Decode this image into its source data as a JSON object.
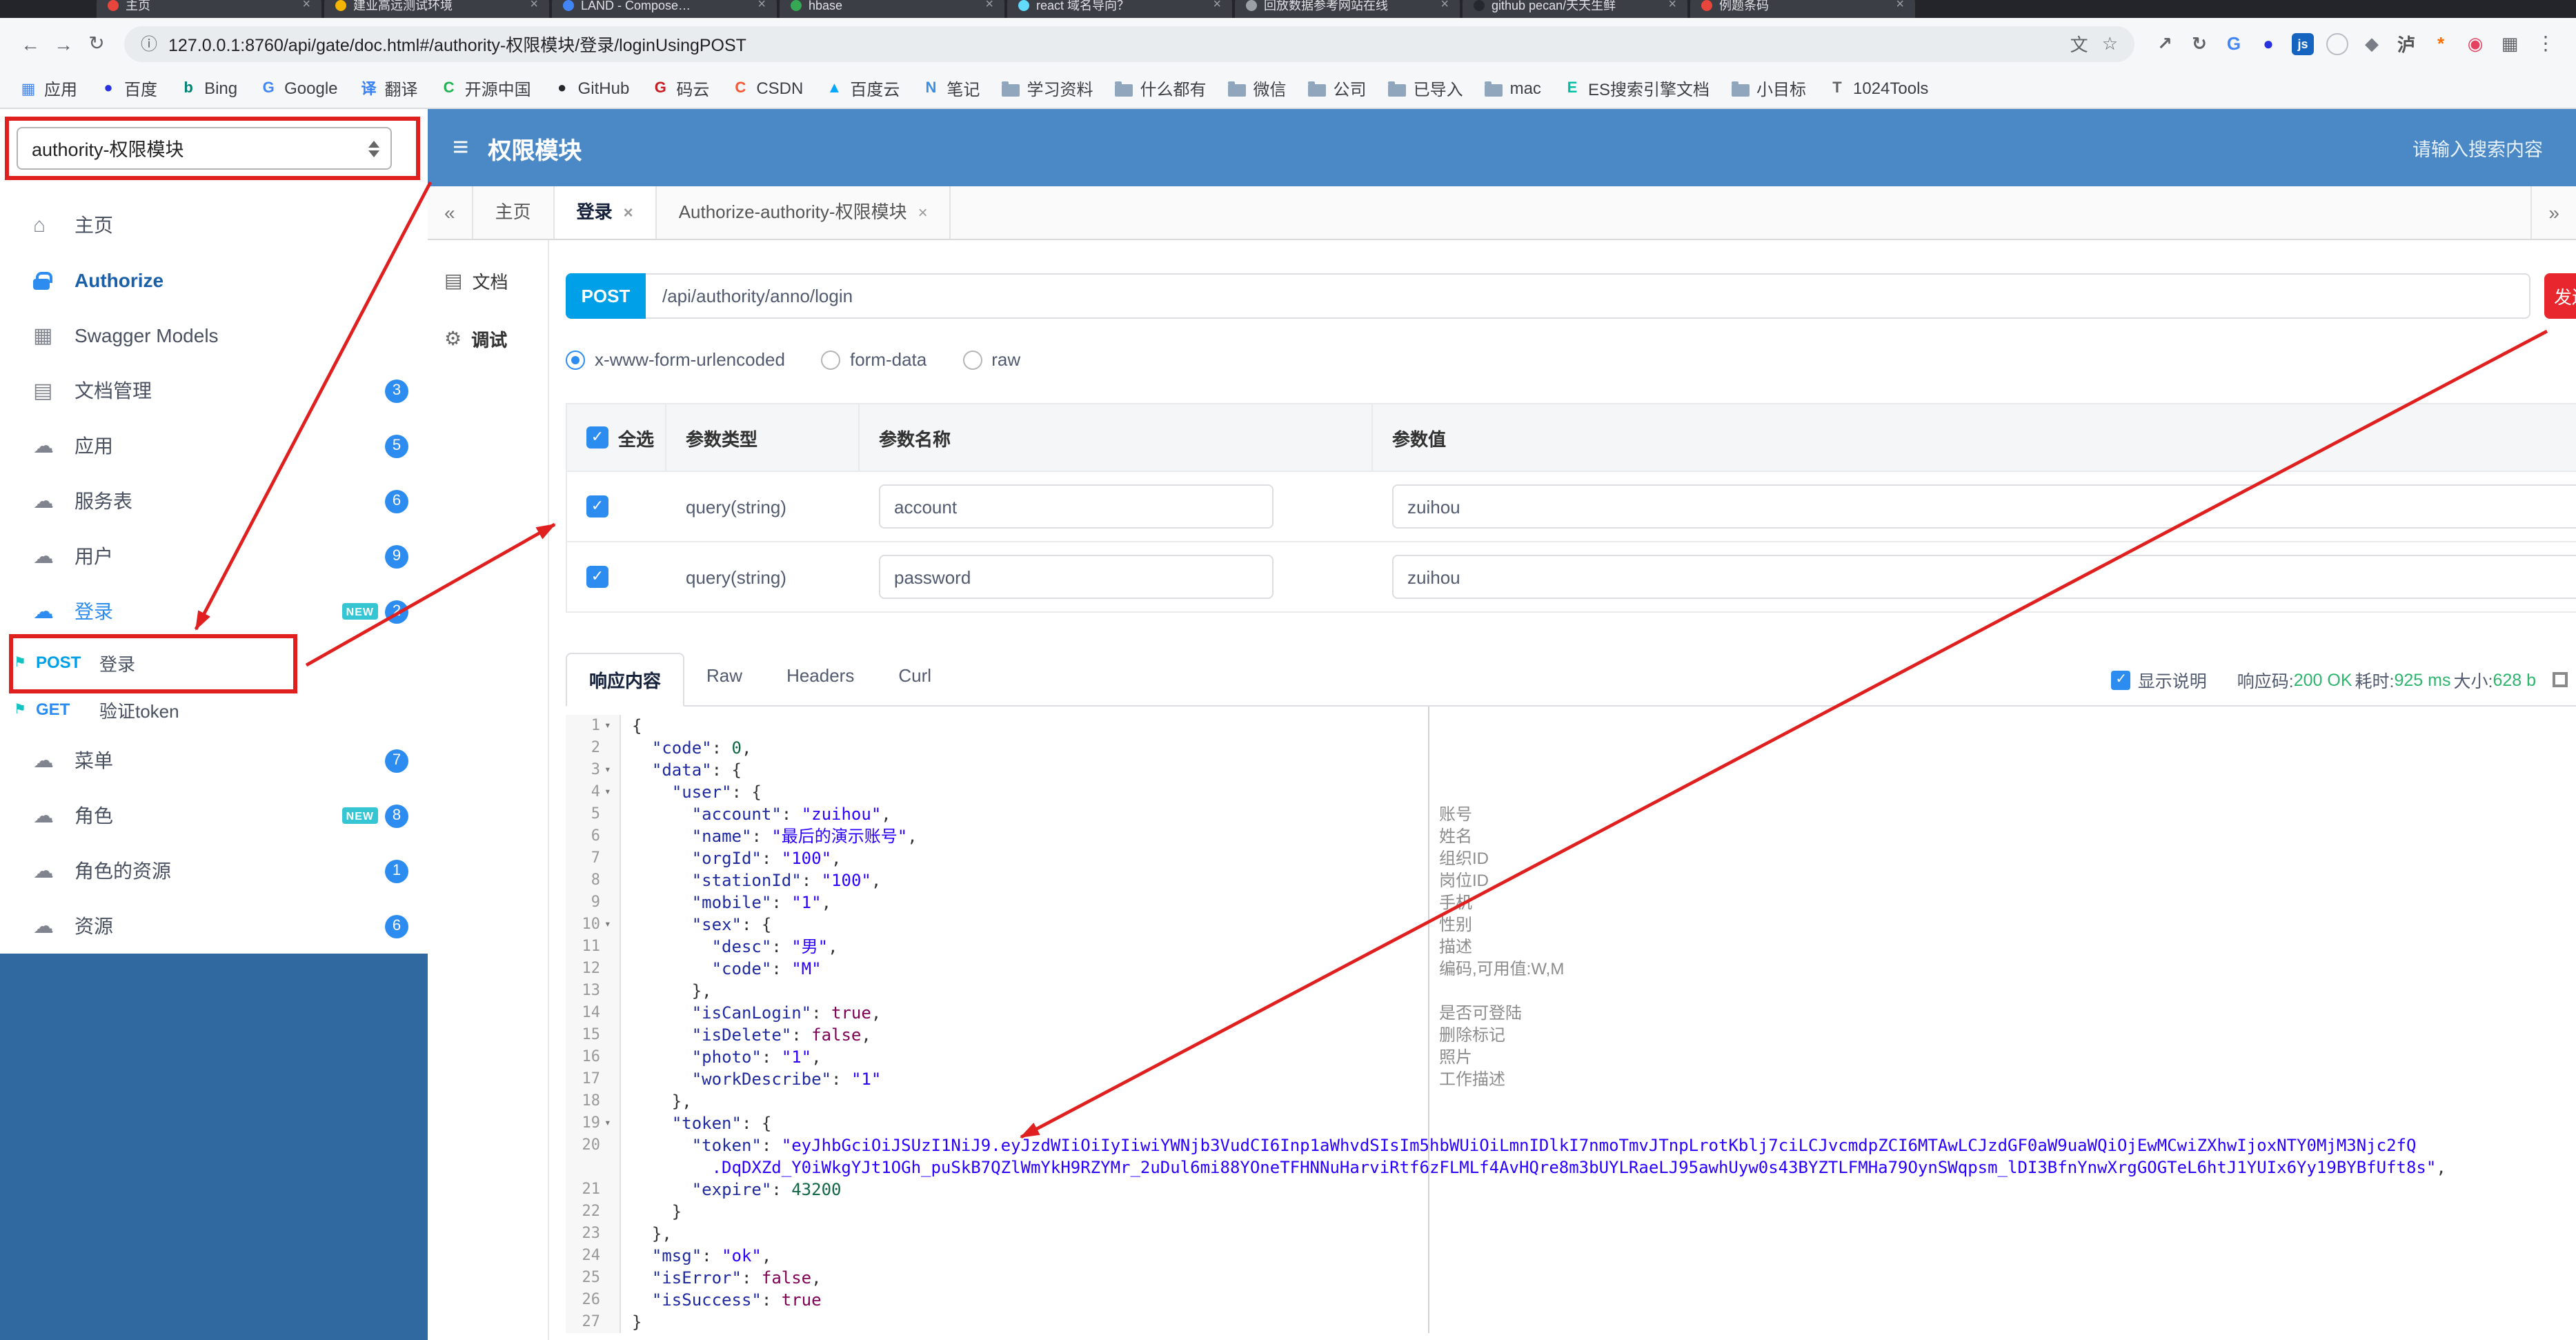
{
  "browser": {
    "window_tabs": [
      {
        "title": "主页",
        "color": "#e8453c"
      },
      {
        "title": "建业高远测试环境",
        "color": "#f4b400"
      },
      {
        "title": "LAND - Compose…",
        "color": "#4285f4"
      },
      {
        "title": "hbase",
        "color": "#34a853"
      },
      {
        "title": "react 域名导向？",
        "color": "#61dafb"
      },
      {
        "title": "回放数据参考网站在线",
        "color": "#9aa0a6"
      },
      {
        "title": "github pecan/天天生鲜",
        "color": "#24292e"
      },
      {
        "title": "例题条码",
        "color": "#e8453c"
      }
    ],
    "nav": {
      "back": "←",
      "forward": "→",
      "reload": "↻",
      "info": "ⓘ",
      "menu": "⋮"
    },
    "url": "127.0.0.1:8760/api/gate/doc.html#/authority-权限模块/登录/loginUsingPOST",
    "omnibox_icons": {
      "translate": "文",
      "star": "☆"
    },
    "ext_icons": [
      {
        "name": "share-extension-icon",
        "glyph": "↗",
        "color": "#5f6368"
      },
      {
        "name": "history-extension-icon",
        "glyph": "↻",
        "color": "#5f6368"
      },
      {
        "name": "google-extension-icon",
        "glyph": "G",
        "color": "#4285f4"
      },
      {
        "name": "paw-extension-icon",
        "glyph": "●",
        "color": "#2932e1"
      },
      {
        "name": "jsfiddle-extension-icon",
        "glyph": "js",
        "bg": "#1565c0",
        "fg": "#ffffff"
      },
      {
        "name": "circle-extension-icon",
        "glyph": "",
        "border": true
      },
      {
        "name": "shield-extension-icon",
        "glyph": "◆",
        "color": "#7a7f87"
      },
      {
        "name": "hujiang-extension-icon",
        "glyph": "泸",
        "color": "#555555"
      },
      {
        "name": "asterisk-extension-icon",
        "glyph": "*",
        "color": "#ff6d00"
      },
      {
        "name": "pin-extension-icon",
        "glyph": "◉",
        "color": "#e4405f"
      },
      {
        "name": "apps-grid-extension-icon",
        "glyph": "▦",
        "color": "#5f6368"
      }
    ],
    "bookmarks": [
      {
        "label": "应用",
        "glyph": "▦",
        "color": "#4285f4"
      },
      {
        "label": "百度",
        "glyph": "●",
        "color": "#2932e1"
      },
      {
        "label": "Bing",
        "glyph": "b",
        "color": "#008373"
      },
      {
        "label": "Google",
        "glyph": "G",
        "color": "#4285f4"
      },
      {
        "label": "翻译",
        "glyph": "译",
        "color": "#3b82f6"
      },
      {
        "label": "开源中国",
        "glyph": "C",
        "color": "#21b351"
      },
      {
        "label": "GitHub",
        "glyph": "●",
        "color": "#24292e"
      },
      {
        "label": "码云",
        "glyph": "G",
        "color": "#c71d23"
      },
      {
        "label": "CSDN",
        "glyph": "C",
        "color": "#fc5531"
      },
      {
        "label": "百度云",
        "glyph": "▲",
        "color": "#06a7ff"
      },
      {
        "label": "笔记",
        "glyph": "N",
        "color": "#3a8ee6"
      },
      {
        "label": "学习资料",
        "folder": true
      },
      {
        "label": "什么都有",
        "folder": true
      },
      {
        "label": "微信",
        "folder": true
      },
      {
        "label": "公司",
        "folder": true
      },
      {
        "label": "已导入",
        "folder": true
      },
      {
        "label": "mac",
        "folder": true
      },
      {
        "label": "ES搜索引擎文档",
        "glyph": "E",
        "color": "#00bfa5"
      },
      {
        "label": "小目标",
        "folder": true
      },
      {
        "label": "1024Tools",
        "glyph": "T",
        "color": "#616161"
      }
    ]
  },
  "header": {
    "group_select": "authority-权限模块",
    "menu_icon": "≡",
    "title": "权限模块",
    "search_placeholder": "请输入搜索内容"
  },
  "sidebar": {
    "items": [
      {
        "id": "home",
        "label": "主页",
        "icon": "home"
      },
      {
        "id": "authorize",
        "label": "Authorize",
        "icon": "lock",
        "strong": true
      },
      {
        "id": "swagger-models",
        "label": "Swagger Models",
        "icon": "grid"
      },
      {
        "id": "docs-manage",
        "label": "文档管理",
        "icon": "doc",
        "badge": "3"
      },
      {
        "id": "app",
        "label": "应用",
        "icon": "cloud",
        "badge": "5"
      },
      {
        "id": "service",
        "label": "服务表",
        "icon": "cloud",
        "badge": "6"
      },
      {
        "id": "user",
        "label": "用户",
        "icon": "cloud",
        "badge": "9"
      },
      {
        "id": "login",
        "label": "登录",
        "icon": "cloud",
        "badge": "2",
        "new": true,
        "active": true,
        "expanded": true
      },
      {
        "id": "menu",
        "label": "菜单",
        "icon": "cloud",
        "badge": "7"
      },
      {
        "id": "role",
        "label": "角色",
        "icon": "cloud",
        "badge": "8",
        "new": true
      },
      {
        "id": "role-resource",
        "label": "角色的资源",
        "icon": "cloud",
        "badge": "1"
      },
      {
        "id": "resource",
        "label": "资源",
        "icon": "cloud",
        "badge": "6"
      }
    ],
    "sub_items": [
      {
        "method": "POST",
        "label": "登录"
      },
      {
        "method": "GET",
        "label": "验证token"
      }
    ]
  },
  "tabs": {
    "collapse_left": "«",
    "collapse_right": "»",
    "items": [
      {
        "label": "主页",
        "closable": false
      },
      {
        "label": "登录",
        "closable": true,
        "active": true
      },
      {
        "label": "Authorize-authority-权限模块",
        "closable": true
      }
    ]
  },
  "side_menu": [
    {
      "label": "文档",
      "icon": "doc"
    },
    {
      "label": "调试",
      "icon": "debug",
      "active": true
    }
  ],
  "debug": {
    "method": "POST",
    "url": "/api/authority/anno/login",
    "send_label": "发送",
    "content_types": [
      "x-www-form-urlencoded",
      "form-data",
      "raw"
    ],
    "selected_content_type": 0,
    "params": {
      "headers": [
        "全选",
        "参数类型",
        "参数名称",
        "参数值"
      ],
      "rows": [
        {
          "checked": true,
          "type": "query(string)",
          "name": "account",
          "value": "zuihou"
        },
        {
          "checked": true,
          "type": "query(string)",
          "name": "password",
          "value": "zuihou"
        }
      ]
    },
    "response_tabs": [
      "响应内容",
      "Raw",
      "Headers",
      "Curl"
    ],
    "active_response_tab": 0,
    "show_desc_label": "显示说明",
    "show_desc_checked": true,
    "status": {
      "code_label": "响应码:",
      "code": "200 OK",
      "time_label": "耗时:",
      "time": "925 ms",
      "size_label": "大小:",
      "size": "628 b"
    }
  },
  "code": {
    "lines": [
      {
        "n": 1,
        "fold": true,
        "parts": [
          [
            "p",
            "{"
          ]
        ]
      },
      {
        "n": 2,
        "parts": [
          [
            "p",
            "  "
          ],
          [
            "k",
            "\"code\""
          ],
          [
            "p",
            ": "
          ],
          [
            "num",
            "0"
          ],
          [
            "p",
            ","
          ]
        ]
      },
      {
        "n": 3,
        "fold": true,
        "parts": [
          [
            "p",
            "  "
          ],
          [
            "k",
            "\"data\""
          ],
          [
            "p",
            ": {"
          ]
        ]
      },
      {
        "n": 4,
        "fold": true,
        "parts": [
          [
            "p",
            "    "
          ],
          [
            "k",
            "\"user\""
          ],
          [
            "p",
            ": {"
          ]
        ]
      },
      {
        "n": 5,
        "parts": [
          [
            "p",
            "      "
          ],
          [
            "k",
            "\"account\""
          ],
          [
            "p",
            ": "
          ],
          [
            "s",
            "\"zuihou\""
          ],
          [
            "p",
            ","
          ]
        ]
      },
      {
        "n": 6,
        "parts": [
          [
            "p",
            "      "
          ],
          [
            "k",
            "\"name\""
          ],
          [
            "p",
            ": "
          ],
          [
            "s",
            "\"最后的演示账号\""
          ],
          [
            "p",
            ","
          ]
        ]
      },
      {
        "n": 7,
        "parts": [
          [
            "p",
            "      "
          ],
          [
            "k",
            "\"orgId\""
          ],
          [
            "p",
            ": "
          ],
          [
            "s",
            "\"100\""
          ],
          [
            "p",
            ","
          ]
        ]
      },
      {
        "n": 8,
        "parts": [
          [
            "p",
            "      "
          ],
          [
            "k",
            "\"stationId\""
          ],
          [
            "p",
            ": "
          ],
          [
            "s",
            "\"100\""
          ],
          [
            "p",
            ","
          ]
        ]
      },
      {
        "n": 9,
        "parts": [
          [
            "p",
            "      "
          ],
          [
            "k",
            "\"mobile\""
          ],
          [
            "p",
            ": "
          ],
          [
            "s",
            "\"1\""
          ],
          [
            "p",
            ","
          ]
        ]
      },
      {
        "n": 10,
        "fold": true,
        "parts": [
          [
            "p",
            "      "
          ],
          [
            "k",
            "\"sex\""
          ],
          [
            "p",
            ": {"
          ]
        ]
      },
      {
        "n": 11,
        "parts": [
          [
            "p",
            "        "
          ],
          [
            "k",
            "\"desc\""
          ],
          [
            "p",
            ": "
          ],
          [
            "s",
            "\"男\""
          ],
          [
            "p",
            ","
          ]
        ]
      },
      {
        "n": 12,
        "parts": [
          [
            "p",
            "        "
          ],
          [
            "k",
            "\"code\""
          ],
          [
            "p",
            ": "
          ],
          [
            "s",
            "\"M\""
          ]
        ]
      },
      {
        "n": 13,
        "parts": [
          [
            "p",
            "      },"
          ]
        ]
      },
      {
        "n": 14,
        "parts": [
          [
            "p",
            "      "
          ],
          [
            "k",
            "\"isCanLogin\""
          ],
          [
            "p",
            ": "
          ],
          [
            "b",
            "true"
          ],
          [
            "p",
            ","
          ]
        ]
      },
      {
        "n": 15,
        "parts": [
          [
            "p",
            "      "
          ],
          [
            "k",
            "\"isDelete\""
          ],
          [
            "p",
            ": "
          ],
          [
            "b",
            "false"
          ],
          [
            "p",
            ","
          ]
        ]
      },
      {
        "n": 16,
        "parts": [
          [
            "p",
            "      "
          ],
          [
            "k",
            "\"photo\""
          ],
          [
            "p",
            ": "
          ],
          [
            "s",
            "\"1\""
          ],
          [
            "p",
            ","
          ]
        ]
      },
      {
        "n": 17,
        "parts": [
          [
            "p",
            "      "
          ],
          [
            "k",
            "\"workDescribe\""
          ],
          [
            "p",
            ": "
          ],
          [
            "s",
            "\"1\""
          ]
        ]
      },
      {
        "n": 18,
        "parts": [
          [
            "p",
            "    },"
          ]
        ]
      },
      {
        "n": 19,
        "fold": true,
        "parts": [
          [
            "p",
            "    "
          ],
          [
            "k",
            "\"token\""
          ],
          [
            "p",
            ": {"
          ]
        ]
      },
      {
        "n": 20,
        "parts": [
          [
            "p",
            "      "
          ],
          [
            "k",
            "\"token\""
          ],
          [
            "p",
            ": "
          ],
          [
            "s",
            "\"eyJhbGciOiJSUzI1NiJ9.eyJzdWIiOiIyIiwiYWNjb3VudCI6Inp1aWhvdSIsIm5hbWUiOiLmnIDlkI7nmoTmvJTnpLrotKblj7ciLCJvcmdpZCI6MTAwLCJzdGF0aW9uaWQiOjEwMCwiZXhwIjoxNTY0MjM3Njc2fQ"
          ],
          [
            "br",
            ""
          ],
          [
            "s",
            "        .DqDXZd_Y0iWkgYJt1OGh_puSkB7QZlWmYkH9RZYMr_2uDul6mi88YOneTFHNNuHarviRtf6zFLMLf4AvHQre8m3bUYLRaeLJ95awhUyw0s43BYZTLFMHa79OynSWqpsm_lDI3BfnYnwXrgGOGTeL6htJ1YUIx6Yy19BYBfUft8s\""
          ],
          [
            "p",
            ","
          ]
        ]
      },
      {
        "n": 21,
        "parts": [
          [
            "p",
            "      "
          ],
          [
            "k",
            "\"expire\""
          ],
          [
            "p",
            ": "
          ],
          [
            "num",
            "43200"
          ]
        ]
      },
      {
        "n": 22,
        "parts": [
          [
            "p",
            "    }"
          ]
        ]
      },
      {
        "n": 23,
        "parts": [
          [
            "p",
            "  },"
          ]
        ]
      },
      {
        "n": 24,
        "parts": [
          [
            "p",
            "  "
          ],
          [
            "k",
            "\"msg\""
          ],
          [
            "p",
            ": "
          ],
          [
            "s",
            "\"ok\""
          ],
          [
            "p",
            ","
          ]
        ]
      },
      {
        "n": 25,
        "parts": [
          [
            "p",
            "  "
          ],
          [
            "k",
            "\"isError\""
          ],
          [
            "p",
            ": "
          ],
          [
            "b",
            "false"
          ],
          [
            "p",
            ","
          ]
        ]
      },
      {
        "n": 26,
        "parts": [
          [
            "p",
            "  "
          ],
          [
            "k",
            "\"isSuccess\""
          ],
          [
            "p",
            ": "
          ],
          [
            "b",
            "true"
          ]
        ]
      },
      {
        "n": 27,
        "parts": [
          [
            "p",
            "}"
          ]
        ]
      }
    ],
    "annotations": [
      {
        "line": 5,
        "text": "账号"
      },
      {
        "line": 6,
        "text": "姓名"
      },
      {
        "line": 7,
        "text": "组织ID"
      },
      {
        "line": 8,
        "text": "岗位ID"
      },
      {
        "line": 9,
        "text": "手机"
      },
      {
        "line": 10,
        "text": "性别"
      },
      {
        "line": 11,
        "text": "描述"
      },
      {
        "line": 12,
        "text": "编码,可用值:W,M"
      },
      {
        "line": 14,
        "text": "是否可登陆"
      },
      {
        "line": 15,
        "text": "删除标记"
      },
      {
        "line": 16,
        "text": "照片"
      },
      {
        "line": 17,
        "text": "工作描述"
      }
    ]
  },
  "overlay_color": "#e01f1f"
}
